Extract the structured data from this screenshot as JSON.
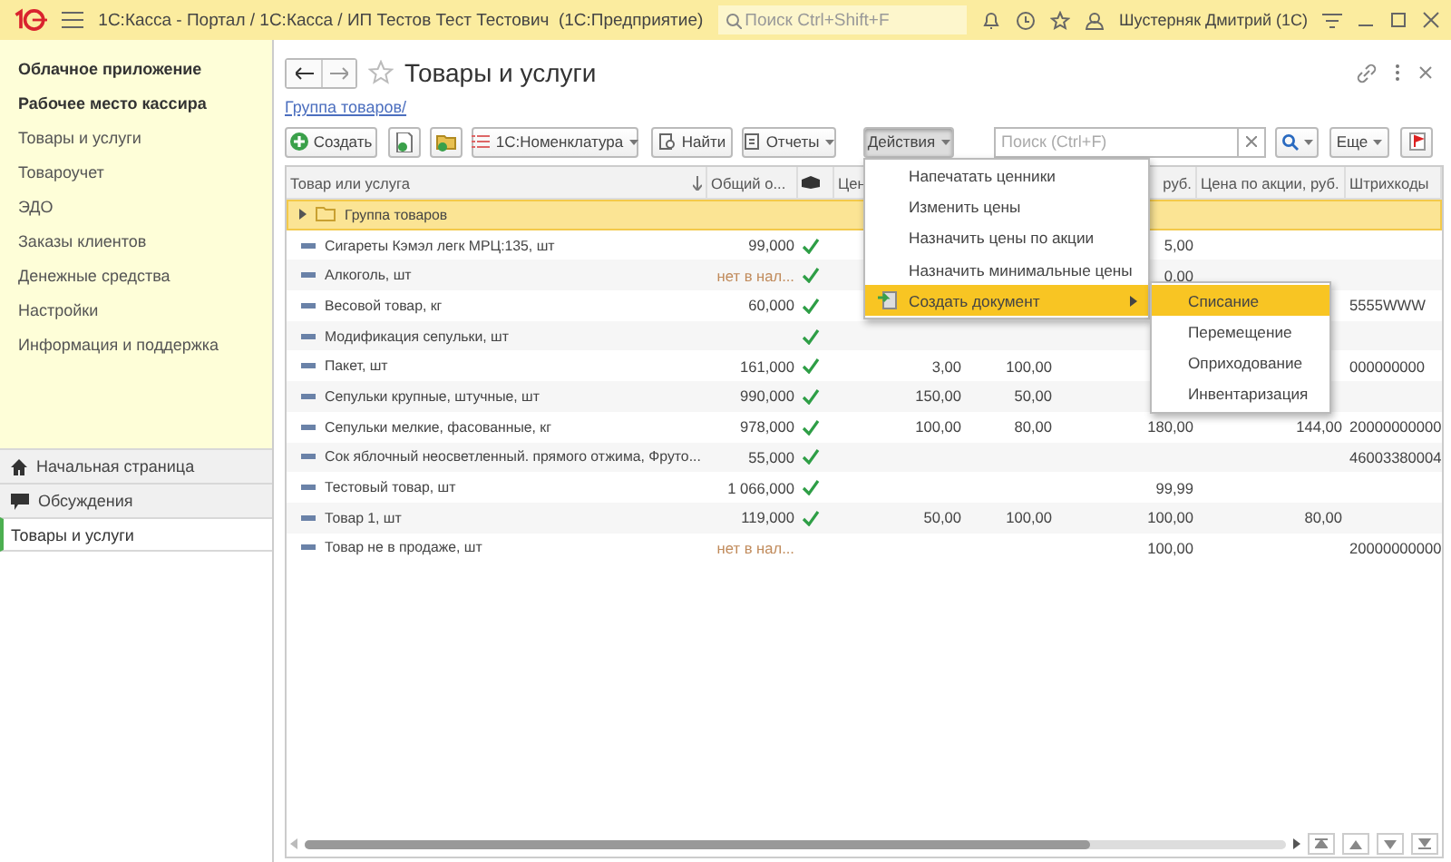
{
  "titlebar": {
    "title": "1С:Касса - Портал / 1С:Касса / ИП Тестов Тест Тестович  (1С:Предприятие)",
    "search": {
      "placeholder": "Поиск Ctrl+Shift+F"
    },
    "user": "Шустерняк Дмитрий (1С)"
  },
  "sidebar": {
    "sections": [
      {
        "label": "Облачное приложение",
        "kind": "heading"
      },
      {
        "label": "Рабочее место кассира",
        "kind": "heading"
      },
      {
        "label": "Товары и услуги",
        "kind": "link"
      },
      {
        "label": "Товароучет",
        "kind": "link"
      },
      {
        "label": "ЭДО",
        "kind": "link"
      },
      {
        "label": "Заказы клиентов",
        "kind": "link"
      },
      {
        "label": "Денежные средства",
        "kind": "link"
      },
      {
        "label": "Настройки",
        "kind": "link"
      },
      {
        "label": "Информация и поддержка",
        "kind": "link"
      }
    ],
    "bottom": [
      {
        "label": "Начальная страница",
        "kind": "home"
      },
      {
        "label": "Обсуждения",
        "kind": "chat"
      }
    ],
    "open_windows": [
      {
        "label": "Товары и услуги",
        "selected": true
      }
    ]
  },
  "form": {
    "title": "Товары и услуги",
    "breadcrumb": "Группа товаров/",
    "toolbar": {
      "create": "Создать",
      "catalog": "1С:Номенклатура",
      "find": "Найти",
      "reports": "Отчеты",
      "actions": {
        "label": "Действия",
        "expanded": true
      },
      "search": {
        "placeholder": "Поиск (Ctrl+F)"
      },
      "more": "Еще"
    },
    "actions_menu": [
      {
        "label": "Напечатать ценники",
        "selected": false
      },
      {
        "label": "Изменить цены",
        "selected": false
      },
      {
        "label": "Назначить цены по акции",
        "selected": false
      },
      {
        "label": "Назначить минимальные цены",
        "selected": false
      },
      {
        "label": "Создать документ",
        "selected": true,
        "submenu": [
          {
            "label": "Списание",
            "selected": true
          },
          {
            "label": "Перемещение",
            "selected": false
          },
          {
            "label": "Оприходование",
            "selected": false
          },
          {
            "label": "Инвентаризация",
            "selected": false
          }
        ]
      }
    ],
    "table": {
      "columns": [
        "Товар или услуга",
        "Общий о...",
        "",
        "Цен",
        "",
        "руб.",
        "Цена по акции, руб.",
        "Штрихкоды"
      ],
      "rows": [
        {
          "kind": "group",
          "name": "Группа товаров"
        },
        {
          "kind": "item",
          "name": "Сигареты Кэмэл легк МРЦ:135, шт",
          "stock": "99,000",
          "in_stock": true,
          "checked": true,
          "cells": [
            "",
            "",
            "5,00",
            "",
            ""
          ]
        },
        {
          "kind": "item",
          "name": "Алкоголь, шт",
          "stock": "нет в нал...",
          "in_stock": false,
          "checked": true,
          "cells": [
            "",
            "",
            "0,00",
            "",
            ""
          ]
        },
        {
          "kind": "item",
          "name": "Весовой товар, кг",
          "stock": "60,000",
          "in_stock": true,
          "checked": true,
          "cells": [
            "",
            "",
            "",
            "",
            "5555WWW"
          ]
        },
        {
          "kind": "item",
          "name": "Модификация сепульки, шт",
          "stock": "",
          "in_stock": true,
          "checked": true,
          "cells": [
            "",
            "",
            "",
            "",
            ""
          ]
        },
        {
          "kind": "item",
          "name": "Пакет, шт",
          "stock": "161,000",
          "in_stock": true,
          "checked": true,
          "cells": [
            "3,00",
            "100,00",
            "",
            "",
            "000000000"
          ]
        },
        {
          "kind": "item",
          "name": "Сепульки крупные, штучные, шт",
          "stock": "990,000",
          "in_stock": true,
          "checked": true,
          "cells": [
            "150,00",
            "50,00",
            "",
            "",
            ""
          ]
        },
        {
          "kind": "item",
          "name": "Сепульки мелкие, фасованные, кг",
          "stock": "978,000",
          "in_stock": true,
          "checked": true,
          "cells": [
            "100,00",
            "80,00",
            "180,00",
            "144,00",
            "20000000000"
          ]
        },
        {
          "kind": "item",
          "name": "Сок яблочный неосветленный. прямого отжима, Фруто...",
          "stock": "55,000",
          "in_stock": true,
          "checked": true,
          "cells": [
            "",
            "",
            "",
            "",
            "46003380004"
          ]
        },
        {
          "kind": "item",
          "name": "Тестовый товар, шт",
          "stock": "1 066,000",
          "in_stock": true,
          "checked": true,
          "cells": [
            "",
            "",
            "99,99",
            "",
            ""
          ]
        },
        {
          "kind": "item",
          "name": "Товар 1, шт",
          "stock": "119,000",
          "in_stock": true,
          "checked": true,
          "cells": [
            "50,00",
            "100,00",
            "100,00",
            "80,00",
            ""
          ]
        },
        {
          "kind": "item",
          "name": "Товар не в продаже, шт",
          "stock": "нет в нал...",
          "in_stock": false,
          "checked": false,
          "cells": [
            "",
            "",
            "100,00",
            "",
            "20000000000"
          ]
        }
      ]
    }
  }
}
